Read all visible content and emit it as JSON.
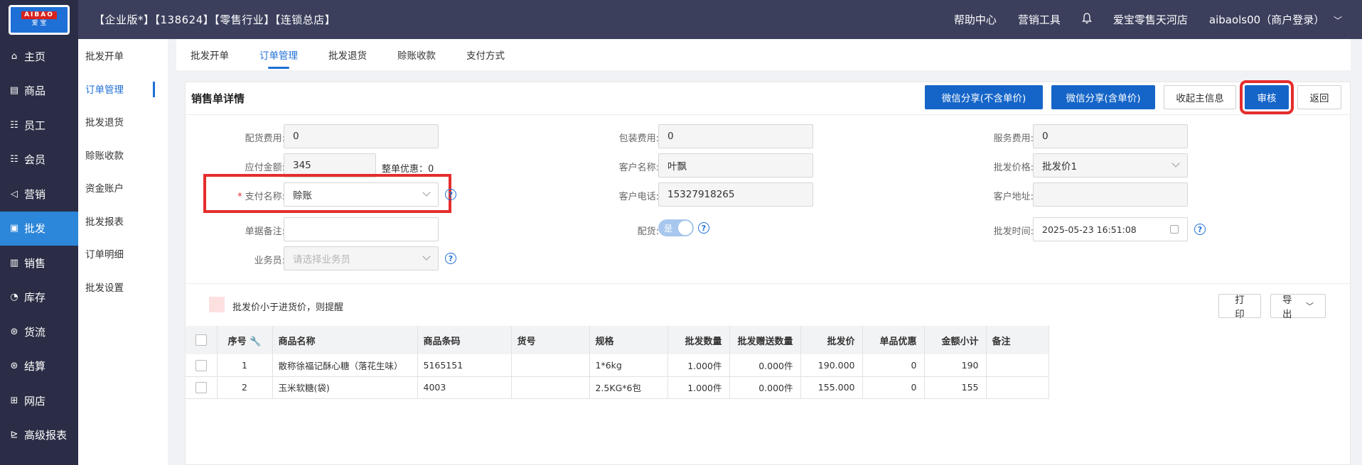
{
  "header": {
    "logo_top": "AIBAO",
    "logo_bottom": "爱 宝",
    "title": "【企业版*】【138624】【零售行业】【连锁总店】",
    "help": "帮助中心",
    "marketing": "营销工具",
    "store": "爱宝零售天河店",
    "user": "aibaols00（商户登录）"
  },
  "sidebar": {
    "items": [
      {
        "label": "主页",
        "icon": "home-icon"
      },
      {
        "label": "商品",
        "icon": "goods-icon"
      },
      {
        "label": "员工",
        "icon": "staff-icon"
      },
      {
        "label": "会员",
        "icon": "member-icon"
      },
      {
        "label": "营销",
        "icon": "megaphone-icon"
      },
      {
        "label": "批发",
        "icon": "wholesale-icon"
      },
      {
        "label": "销售",
        "icon": "chart-icon"
      },
      {
        "label": "库存",
        "icon": "stock-icon"
      },
      {
        "label": "货流",
        "icon": "flow-icon"
      },
      {
        "label": "结算",
        "icon": "settle-icon"
      },
      {
        "label": "网店",
        "icon": "shop-icon"
      },
      {
        "label": "高级报表",
        "icon": "report-icon"
      }
    ]
  },
  "subnav": {
    "items": [
      "批发开单",
      "订单管理",
      "批发退货",
      "赊账收款",
      "资金账户",
      "批发报表",
      "订单明细",
      "批发设置"
    ]
  },
  "tabs": [
    "批发开单",
    "订单管理",
    "批发退货",
    "赊账收款",
    "支付方式"
  ],
  "panel": {
    "title": "销售单详情",
    "btn_share_no_price": "微信分享(不含单价)",
    "btn_share_price": "微信分享(含单价)",
    "btn_collapse": "收起主信息",
    "btn_audit": "审核",
    "btn_back": "返回"
  },
  "form": {
    "delivery_fee_label": "配货费用:",
    "delivery_fee": "0",
    "payable_label": "应付金额:",
    "payable": "345",
    "whole_discount": "整单优惠：0",
    "pay_name_label": "支付名称:",
    "pay_name": "赊账",
    "remark_label": "单据备注:",
    "salesman_label": "业务员:",
    "salesman_placeholder": "请选择业务员",
    "pack_fee_label": "包装费用:",
    "pack_fee": "0",
    "customer_label": "客户名称:",
    "customer": "叶飘",
    "phone_label": "客户电话:",
    "phone": "15327918265",
    "delivery_label": "配货:",
    "delivery_toggle": "是",
    "service_fee_label": "服务费用:",
    "service_fee": "0",
    "price_label": "批发价格:",
    "price": "批发价1",
    "address_label": "客户地址:",
    "time_label": "批发时间:",
    "time": "2025-05-23 16:51:08"
  },
  "legend": "批发价小于进货价，则提醒",
  "btn_print": "打印",
  "btn_export": "导出",
  "table": {
    "headers": [
      "序号",
      "商品名称",
      "商品条码",
      "货号",
      "规格",
      "批发数量",
      "批发赠送数量",
      "批发价",
      "单品优惠",
      "金额小计",
      "备注"
    ],
    "rows": [
      [
        "1",
        "散称徐福记酥心糖（落花生味）",
        "5165151",
        "",
        "1*6kg",
        "1.000件",
        "0.000件",
        "190.000",
        "0",
        "190",
        ""
      ],
      [
        "2",
        "玉米软糖(袋)",
        "4003",
        "",
        "2.5KG*6包",
        "1.000件",
        "0.000件",
        "155.000",
        "0",
        "155",
        ""
      ]
    ]
  }
}
